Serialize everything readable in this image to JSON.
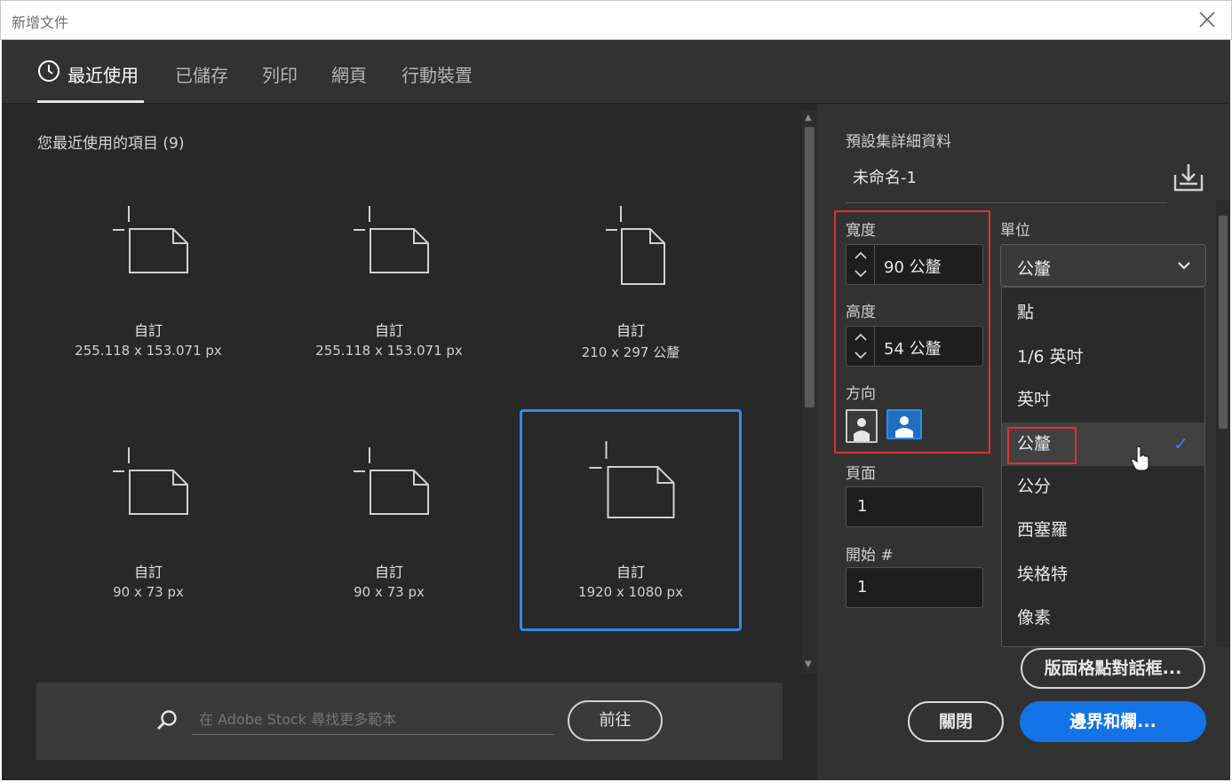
{
  "window": {
    "title": "新增文件"
  },
  "tabs": [
    {
      "label": "最近使用",
      "active": true,
      "icon": "clock-icon"
    },
    {
      "label": "已儲存"
    },
    {
      "label": "列印"
    },
    {
      "label": "網頁"
    },
    {
      "label": "行動裝置"
    }
  ],
  "recent": {
    "title": "您最近使用的項目 (9)",
    "items": [
      {
        "name": "自訂",
        "size": "255.118 x 153.071 px",
        "orientation": "landscape"
      },
      {
        "name": "自訂",
        "size": "255.118 x 153.071 px",
        "orientation": "landscape"
      },
      {
        "name": "自訂",
        "size": "210 x 297 公釐",
        "orientation": "portrait"
      },
      {
        "name": "自訂",
        "size": "90 x 73 px",
        "orientation": "landscape"
      },
      {
        "name": "自訂",
        "size": "90 x 73 px",
        "orientation": "landscape"
      },
      {
        "name": "自訂",
        "size": "1920 x 1080 px",
        "orientation": "landscape",
        "selected": true
      }
    ]
  },
  "stock": {
    "placeholder": "在 Adobe Stock 尋找更多範本",
    "go_label": "前往"
  },
  "preset": {
    "title": "預設集詳細資料",
    "doc_name": "未命名-1",
    "width_label": "寬度",
    "width_value": "90 公釐",
    "height_label": "高度",
    "height_value": "54 公釐",
    "orientation_label": "方向",
    "pages_label": "頁面",
    "pages_value": "1",
    "start_label": "開始 #",
    "start_value": "1",
    "units_label": "單位",
    "units_value": "公釐",
    "unit_options": [
      "點",
      "1/6 英吋",
      "英吋",
      "公釐",
      "公分",
      "西塞羅",
      "埃格特",
      "像素"
    ],
    "selected_unit_index": 3
  },
  "buttons": {
    "grid_dialog": "版面格點對話框...",
    "close": "關閉",
    "margins": "邊界和欄..."
  },
  "colors": {
    "accent": "#1473e6",
    "highlight": "#e03030",
    "selection_border": "#2d8ceb"
  }
}
